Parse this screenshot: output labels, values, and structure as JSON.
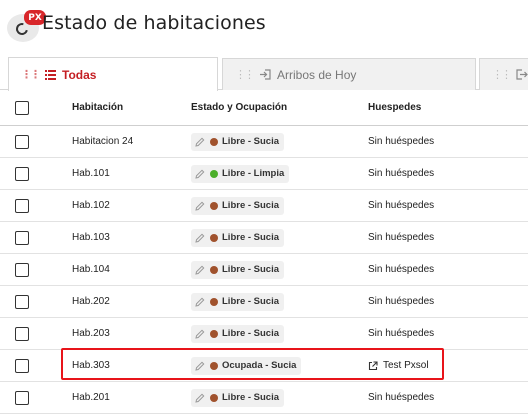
{
  "header": {
    "logo_badge": "PX",
    "title": "Estado de habitaciones"
  },
  "tabs": [
    {
      "label": "Todas",
      "active": true
    },
    {
      "label": "Arribos de Hoy",
      "active": false
    },
    {
      "label": "Ch",
      "active": false
    }
  ],
  "table": {
    "columns": [
      "Habitación",
      "Estado y Ocupación",
      "Huespedes"
    ],
    "rows": [
      {
        "room": "Habitacion 24",
        "state": "Libre - Sucia",
        "status_color": "#a0522d",
        "guests": "Sin huéspedes",
        "has_link": false
      },
      {
        "room": "Hab.101",
        "state": "Libre - Limpia",
        "status_color": "#4caf2a",
        "guests": "Sin huéspedes",
        "has_link": false
      },
      {
        "room": "Hab.102",
        "state": "Libre - Sucia",
        "status_color": "#a0522d",
        "guests": "Sin huéspedes",
        "has_link": false
      },
      {
        "room": "Hab.103",
        "state": "Libre - Sucia",
        "status_color": "#a0522d",
        "guests": "Sin huéspedes",
        "has_link": false
      },
      {
        "room": "Hab.104",
        "state": "Libre - Sucia",
        "status_color": "#a0522d",
        "guests": "Sin huéspedes",
        "has_link": false
      },
      {
        "room": "Hab.202",
        "state": "Libre - Sucia",
        "status_color": "#a0522d",
        "guests": "Sin huéspedes",
        "has_link": false
      },
      {
        "room": "Hab.203",
        "state": "Libre - Sucia",
        "status_color": "#a0522d",
        "guests": "Sin huéspedes",
        "has_link": false
      },
      {
        "room": "Hab.303",
        "state": "Ocupada - Sucia",
        "status_color": "#a0522d",
        "guests": "Test Pxsol",
        "has_link": true
      },
      {
        "room": "Hab.201",
        "state": "Libre - Sucia",
        "status_color": "#a0522d",
        "guests": "Sin huéspedes",
        "has_link": false
      }
    ]
  },
  "colors": {
    "accent": "#c41e23",
    "highlight": "#e8141a",
    "dirty": "#a0522d",
    "clean": "#4caf2a"
  }
}
